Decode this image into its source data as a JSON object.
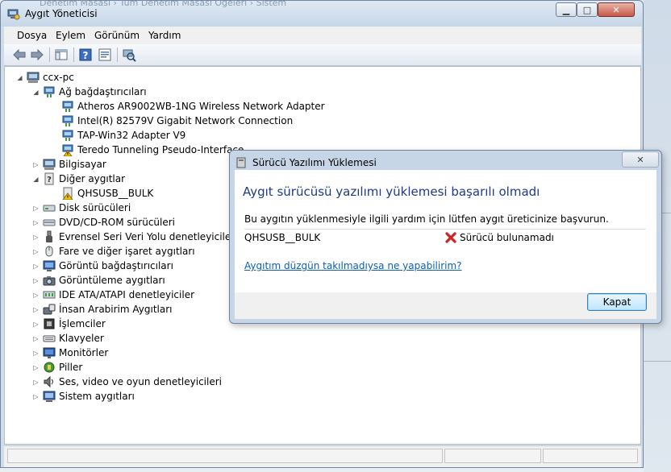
{
  "window": {
    "title": "Aygıt Yöneticisi",
    "ghost_breadcrumb": "Denetim Masası  ›  Tüm Denetim Masası Öğeleri  ›  Sistem"
  },
  "menu": [
    "Dosya",
    "Eylem",
    "Görünüm",
    "Yardım"
  ],
  "tree": {
    "root": "ccx-pc",
    "network_adapters": {
      "label": "Ağ bağdaştırıcıları",
      "children": [
        "Atheros AR9002WB-1NG Wireless Network Adapter",
        "Intel(R) 82579V Gigabit Network Connection",
        "TAP-Win32 Adapter V9",
        "Teredo Tunneling Pseudo-Interface"
      ]
    },
    "computer": "Bilgisayar",
    "other_devices": {
      "label": "Diğer aygıtlar",
      "children": [
        "QHSUSB__BULK"
      ]
    },
    "categories": [
      "Disk sürücüleri",
      "DVD/CD-ROM sürücüleri",
      "Evrensel Seri Veri Yolu denetleyicileri",
      "Fare ve diğer işaret aygıtları",
      "Görüntü bağdaştırıcıları",
      "Görüntüleme aygıtları",
      "IDE ATA/ATAPI denetleyiciler",
      "İnsan Arabirim Aygıtları",
      "İşlemciler",
      "Klavyeler",
      "Monitörler",
      "Piller",
      "Ses, video ve oyun denetleyicileri",
      "Sistem aygıtları"
    ]
  },
  "dialog": {
    "title": "Sürücü Yazılımı Yüklemesi",
    "heading": "Aygıt sürücüsü yazılımı yüklemesi başarılı olmadı",
    "message": "Bu aygıtın yüklenmesiyle ilgili yardım için lütfen aygıt üreticinize başvurun.",
    "device": "QHSUSB__BULK",
    "status": "Sürücü bulunamadı",
    "link": "Aygıtım düzgün takılmadıysa ne yapabilirim?",
    "close_button": "Kapat"
  },
  "colors": {
    "dialog_heading": "#1e3a8a",
    "link": "#0b5fb7",
    "error_red": "#d32020"
  }
}
